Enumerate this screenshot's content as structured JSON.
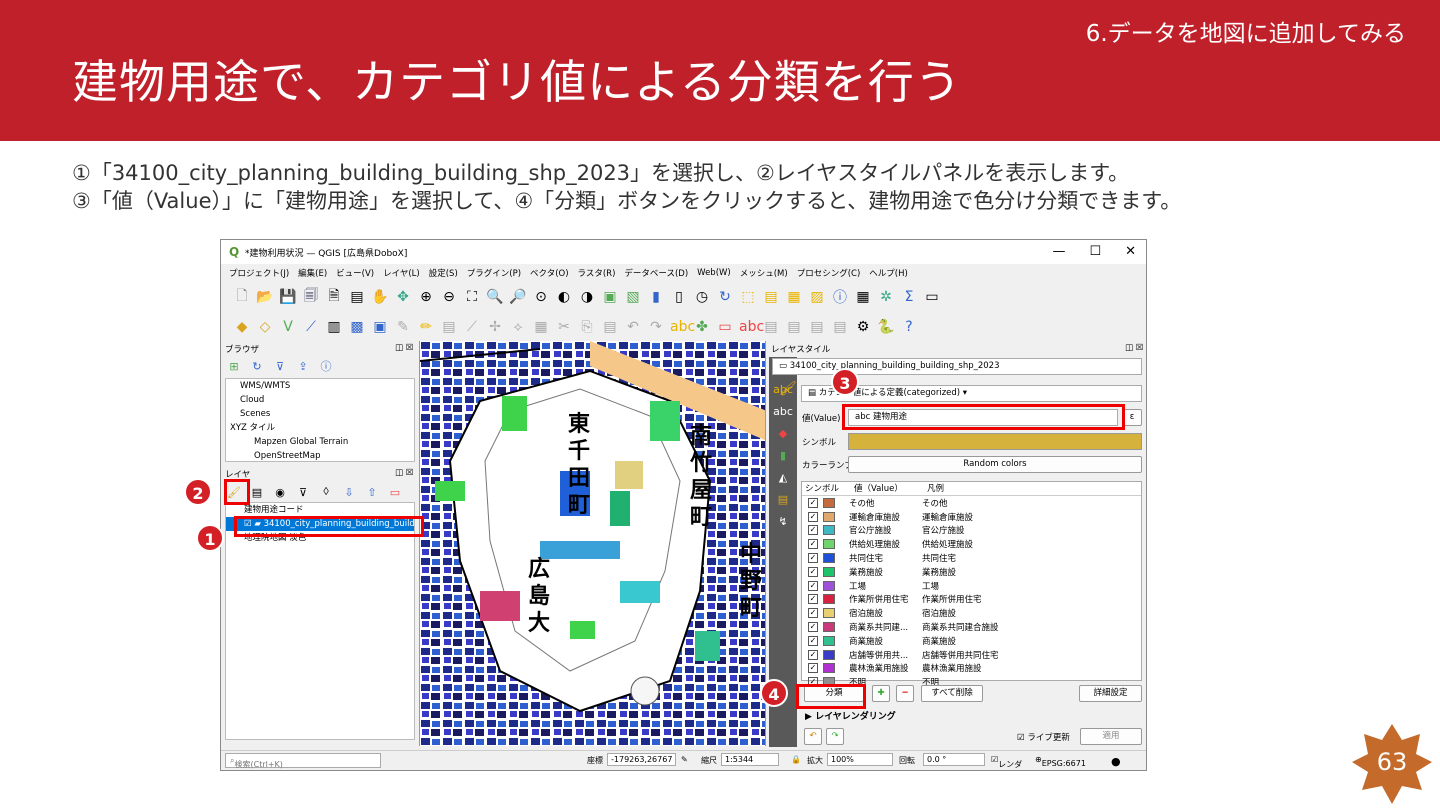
{
  "section": "6.データを地図に追加してみる",
  "title": "建物用途で、カテゴリ値による分類を行う",
  "instructions": [
    "①「34100_city_planning_building_building_shp_2023」を選択し、②レイヤスタイルパネルを表示します。",
    "③「値（Value）」に「建物用途」を選択して、④「分類」ボタンをクリックすると、建物用途で色分け分類できます。"
  ],
  "window": {
    "title": "*建物利用状況 — QGIS [広島県DoboX]",
    "controls": [
      "—",
      "☐",
      "✕"
    ],
    "menu": [
      "プロジェクト(J)",
      "編集(E)",
      "ビュー(V)",
      "レイヤ(L)",
      "設定(S)",
      "プラグイン(P)",
      "ベクタ(O)",
      "ラスタ(R)",
      "データベース(D)",
      "Web(W)",
      "メッシュ(M)",
      "プロセシング(C)",
      "ヘルプ(H)"
    ]
  },
  "browser": {
    "title": "ブラウザ",
    "items": [
      "WMS/WMTS",
      "Cloud",
      "Scenes",
      "XYZ タイル",
      "Mapzen Global Terrain",
      "OpenStreetMap"
    ]
  },
  "layers": {
    "title": "レイヤ",
    "items": [
      "建物用途コード",
      "34100_city_planning_building_building_shp_2023",
      "地理院地図 淡色"
    ]
  },
  "map_labels": [
    "東",
    "千",
    "田",
    "町",
    "南",
    "竹",
    "屋",
    "町",
    "広",
    "島",
    "大",
    "中",
    "野",
    "町"
  ],
  "layer_style": {
    "title": "レイヤスタイル",
    "layer": "34100_city_planning_building_building_shp_2023",
    "renderer": "カテゴリ値による定義(categorized)",
    "value_label": "値(Value)",
    "value": "建物用途",
    "symbol_label": "シンボル",
    "symbol_color": "#d4b23c",
    "ramp_label": "カラーランプ",
    "ramp": "Random colors",
    "columns": [
      "シンボル",
      "値（Value）",
      "凡例"
    ],
    "categories": [
      {
        "value": "その他",
        "legend": "その他",
        "color": "#c46a3c"
      },
      {
        "value": "運輸倉庫施設",
        "legend": "運輸倉庫施設",
        "color": "#e0a86a"
      },
      {
        "value": "官公庁施設",
        "legend": "官公庁施設",
        "color": "#3fb8c4"
      },
      {
        "value": "供給処理施設",
        "legend": "供給処理施設",
        "color": "#6fd46a"
      },
      {
        "value": "共同住宅",
        "legend": "共同住宅",
        "color": "#2050d8"
      },
      {
        "value": "業務施設",
        "legend": "業務施設",
        "color": "#1fc46a"
      },
      {
        "value": "工場",
        "legend": "工場",
        "color": "#a050d8"
      },
      {
        "value": "作業所併用住宅",
        "legend": "作業所併用住宅",
        "color": "#d82040"
      },
      {
        "value": "宿泊施設",
        "legend": "宿泊施設",
        "color": "#e8d070"
      },
      {
        "value": "商業系共同建...",
        "legend": "商業系共同建合施設",
        "color": "#c83a7a"
      },
      {
        "value": "商業施設",
        "legend": "商業施設",
        "color": "#30c090"
      },
      {
        "value": "店舗等併用共...",
        "legend": "店舗等併用共同住宅",
        "color": "#3a3ac8"
      },
      {
        "value": "農林漁業用施設",
        "legend": "農林漁業用施設",
        "color": "#b030d0"
      },
      {
        "value": "不明",
        "legend": "不明",
        "color": "#909090"
      }
    ],
    "classify_button": "分類",
    "delete_all": "すべて削除",
    "advanced": "詳細設定",
    "rendering": "レイヤレンダリング",
    "live_update": "ライブ更新",
    "apply": "適用"
  },
  "status": {
    "search": "検索(Ctrl+K)",
    "coord_label": "座標",
    "coord": "-179263,26767",
    "scale_label": "縮尺",
    "scale": "1:5344",
    "zoom_label": "拡大",
    "zoom": "100%",
    "rot_label": "回転",
    "rot": "0.0 °",
    "render": "レンダ",
    "crs": "EPSG:6671"
  },
  "badges": [
    "1",
    "2",
    "3",
    "4"
  ],
  "page_number": "63"
}
